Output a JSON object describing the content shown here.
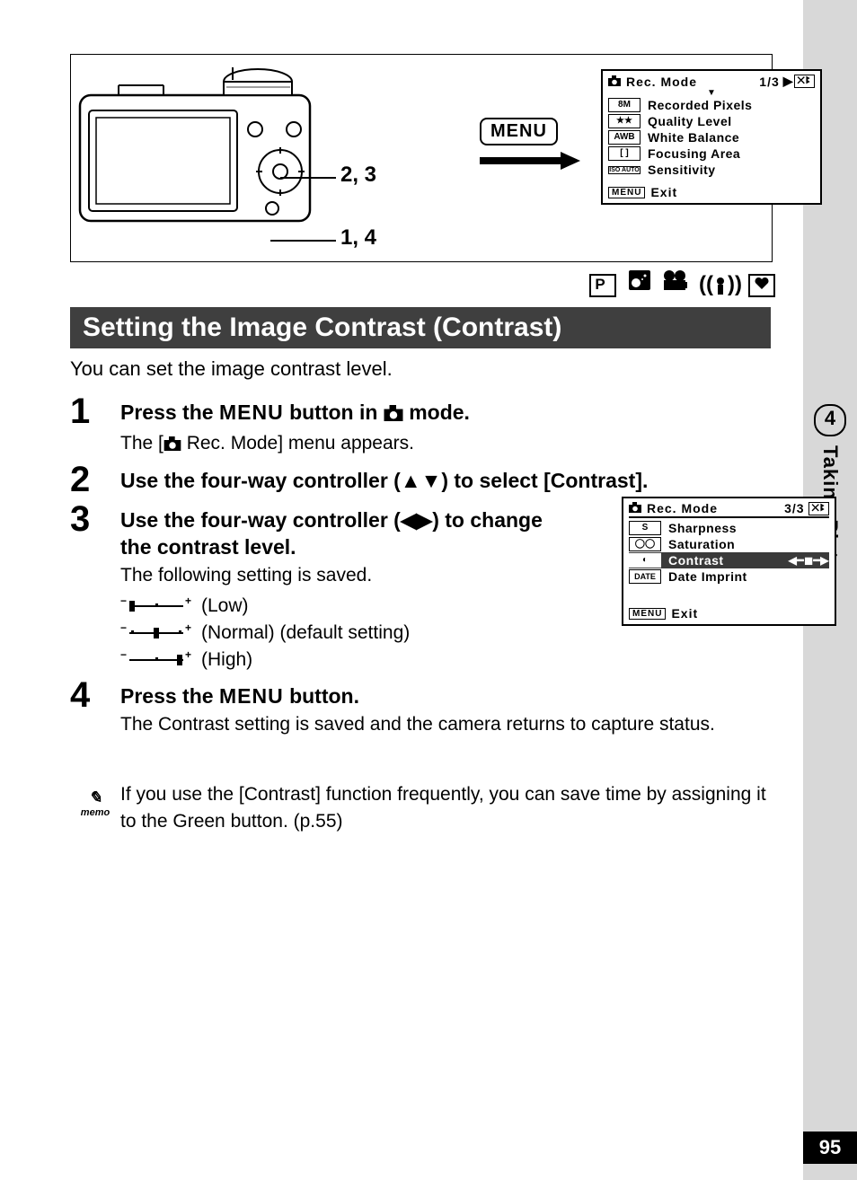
{
  "side": {
    "chapter_number": "4",
    "chapter_title": "Taking Pictures",
    "page_number": "95"
  },
  "top_figure": {
    "label_upper": "2, 3",
    "label_lower": "1, 4",
    "menu_chip": "MENU"
  },
  "lcd_top": {
    "title": "Rec. Mode",
    "page_indicator": "1/3",
    "exit_label": "Exit",
    "menu_badge": "MENU",
    "rows": [
      {
        "badge": "8M",
        "label": "Recorded Pixels"
      },
      {
        "badge": "★★",
        "label": "Quality Level"
      },
      {
        "badge": "AWB",
        "label": "White Balance"
      },
      {
        "badge": "[ ]",
        "label": "Focusing Area"
      },
      {
        "badge": "ISO AUTO",
        "label": "Sensitivity"
      }
    ]
  },
  "lcd_side": {
    "title": "Rec. Mode",
    "page_indicator": "3/3",
    "exit_label": "Exit",
    "menu_badge": "MENU",
    "rows": [
      {
        "badge": "S",
        "label": "Sharpness"
      },
      {
        "badge": "◯◯",
        "label": "Saturation"
      },
      {
        "badge": "◐",
        "label": "Contrast"
      },
      {
        "badge": "DATE",
        "label": "Date Imprint"
      }
    ]
  },
  "mode_icons": {
    "p_box": "P"
  },
  "section": {
    "title": "Setting the Image Contrast (Contrast)",
    "lead": "You can set the image contrast level."
  },
  "steps": [
    {
      "num": "1",
      "title_parts": [
        "Press the ",
        "MENU",
        " button in ",
        "camera",
        " mode."
      ],
      "desc_parts": [
        "The [",
        "camera",
        " Rec. Mode] menu appears."
      ]
    },
    {
      "num": "2",
      "title": "Use the four-way controller (▲▼) to select [Contrast]."
    },
    {
      "num": "3",
      "title": "Use the four-way controller (◀▶) to change the contrast level.",
      "desc": "The following setting is saved.",
      "sliders": [
        {
          "pos": "low",
          "label": "(Low)"
        },
        {
          "pos": "normal",
          "label": "(Normal) (default setting)"
        },
        {
          "pos": "high",
          "label": "(High)"
        }
      ]
    },
    {
      "num": "4",
      "title_parts": [
        "Press the ",
        "MENU",
        " button."
      ],
      "desc": "The Contrast setting is saved and the camera returns to capture status."
    }
  ],
  "memo": {
    "icon_label": "memo",
    "text": "If you use the [Contrast] function frequently, you can save time by assigning it to the Green button. (p.55)"
  }
}
